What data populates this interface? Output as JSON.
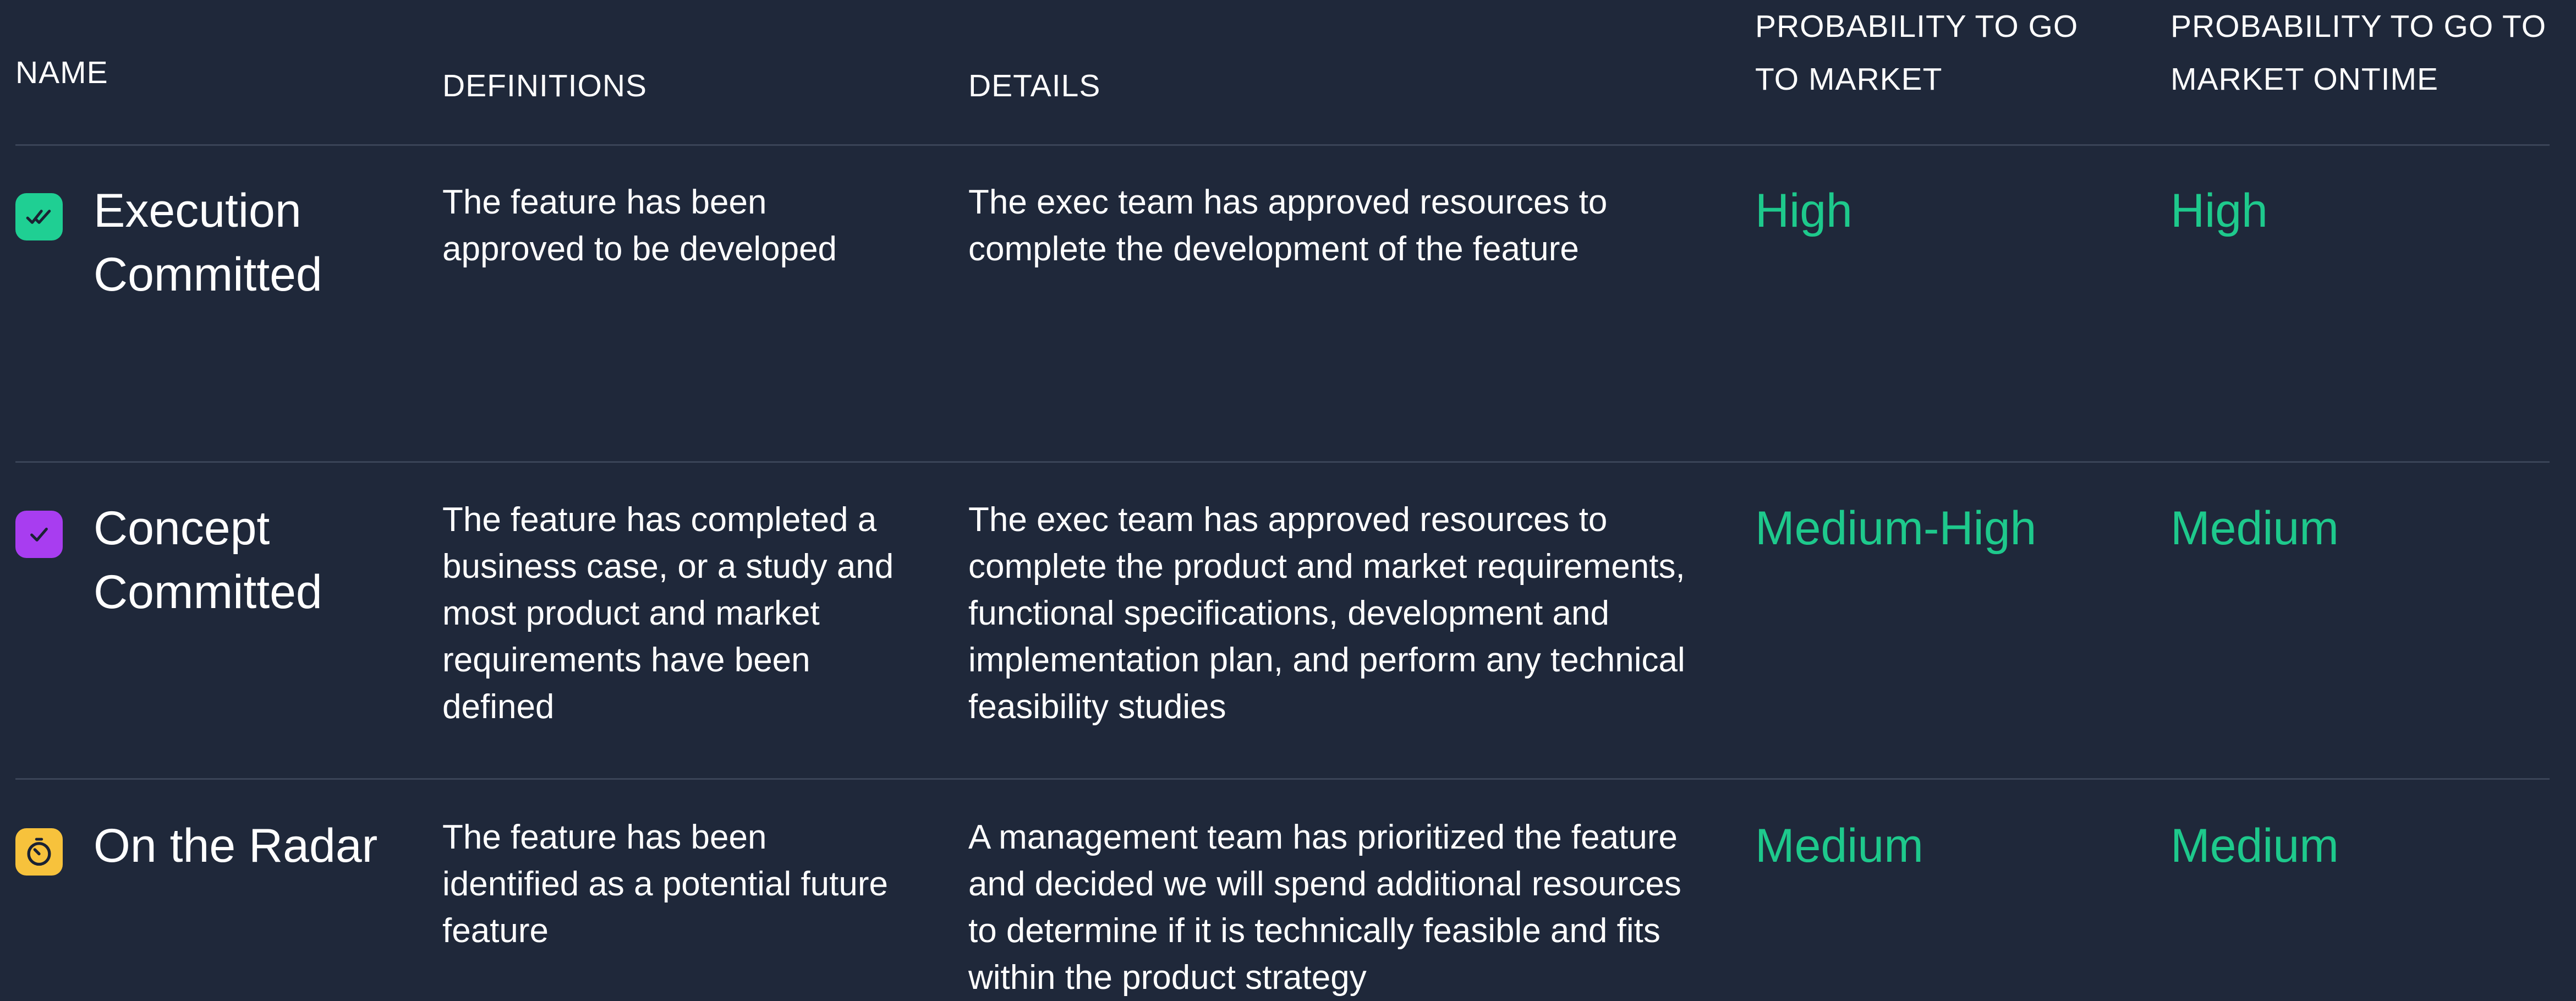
{
  "colors": {
    "background": "#1f283a",
    "divider": "#3a4457",
    "probability_text": "#1ec98c",
    "execution_icon_bg": "#1fcf93",
    "concept_icon_bg": "#a83df0",
    "radar_icon_bg": "#f7c23c"
  },
  "header": {
    "name": "NAME",
    "definitions": "DEFINITIONS",
    "details": "DETAILS",
    "prob_market": "PROBABILITY TO GO TO MARKET",
    "prob_ontime": "PROBABILITY TO GO TO MARKET ONTIME"
  },
  "rows": [
    {
      "icon": "double-check-icon",
      "name": "Execution Committed",
      "definition": "The feature has been approved to be developed",
      "details": "The exec team has approved resources to complete the development of the feature",
      "prob_market": "High",
      "prob_ontime": "High"
    },
    {
      "icon": "check-icon",
      "name": "Concept Committed",
      "definition": "The feature has completed a business case, or a study and most product and market requirements have been defined",
      "details": "The exec team has approved resources to complete the product and market requirements, functional specifications, development and implementation plan, and perform any technical feasibility studies",
      "prob_market": "Medium-High",
      "prob_ontime": "Medium"
    },
    {
      "icon": "stopwatch-icon",
      "name": "On the Radar",
      "definition": "The feature has been identified as a potential future feature",
      "details": "A management team has prioritized the feature and decided we will spend additional resources to determine if it is technically feasible and fits within the product strategy",
      "prob_market": "Medium",
      "prob_ontime": "Medium"
    }
  ]
}
